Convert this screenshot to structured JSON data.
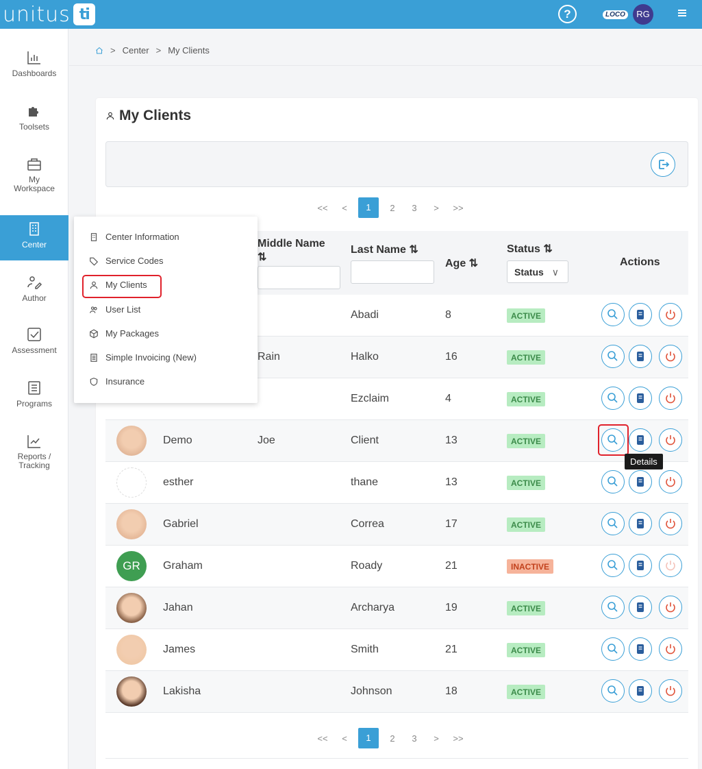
{
  "brand": {
    "name": "unitus",
    "mark": "ti"
  },
  "header": {
    "loco_label": "LOCO",
    "user_initials": "RG"
  },
  "sidebar": {
    "items": [
      {
        "label": "Dashboards"
      },
      {
        "label": "Toolsets"
      },
      {
        "label": "My Workspace"
      },
      {
        "label": "Center"
      },
      {
        "label": "Author"
      },
      {
        "label": "Assessment"
      },
      {
        "label": "Programs"
      },
      {
        "label": "Reports / Tracking"
      }
    ]
  },
  "breadcrumb": [
    "Center",
    "My Clients"
  ],
  "page": {
    "title": "My Clients"
  },
  "pagination": {
    "first": "<<",
    "prev": "<",
    "pages": [
      "1",
      "2",
      "3"
    ],
    "current": "1",
    "next": ">",
    "last": ">>"
  },
  "table": {
    "headers": {
      "middle": "Middle Name",
      "middle_sort": "⇅",
      "last": "Last Name ⇅",
      "age": "Age ⇅",
      "status": "Status ⇅",
      "actions": "Actions"
    },
    "status_filter": "Status",
    "rows": [
      {
        "first": "",
        "middle": "",
        "last": "Abadi",
        "age": "8",
        "status": "ACTIVE"
      },
      {
        "first": "",
        "middle": "Rain",
        "last": "Halko",
        "age": "16",
        "status": "ACTIVE"
      },
      {
        "first": "",
        "middle": "",
        "last": "Ezclaim",
        "age": "4",
        "status": "ACTIVE"
      },
      {
        "first": "Demo",
        "middle": "Joe",
        "last": "Client",
        "age": "13",
        "status": "ACTIVE"
      },
      {
        "first": "esther",
        "middle": "",
        "last": "thane",
        "age": "13",
        "status": "ACTIVE"
      },
      {
        "first": "Gabriel",
        "middle": "",
        "last": "Correa",
        "age": "17",
        "status": "ACTIVE"
      },
      {
        "first": "Graham",
        "middle": "",
        "last": "Roady",
        "age": "21",
        "status": "INACTIVE",
        "initials": "GR"
      },
      {
        "first": "Jahan",
        "middle": "",
        "last": "Archarya",
        "age": "19",
        "status": "ACTIVE"
      },
      {
        "first": "James",
        "middle": "",
        "last": "Smith",
        "age": "21",
        "status": "ACTIVE"
      },
      {
        "first": "Lakisha",
        "middle": "",
        "last": "Johnson",
        "age": "18",
        "status": "ACTIVE"
      }
    ]
  },
  "tooltip": "Details",
  "dropdown": {
    "items": [
      {
        "label": "Center Information"
      },
      {
        "label": "Service Codes"
      },
      {
        "label": "My Clients"
      },
      {
        "label": "User List"
      },
      {
        "label": "My Packages"
      },
      {
        "label": "Simple Invoicing (New)"
      },
      {
        "label": "Insurance"
      }
    ]
  },
  "colors": {
    "accent": "#3a9fd6",
    "active_bg": "#b7ecc1",
    "inactive_bg": "#f6b39a",
    "highlight": "#e0212b",
    "power": "#e0533a"
  }
}
